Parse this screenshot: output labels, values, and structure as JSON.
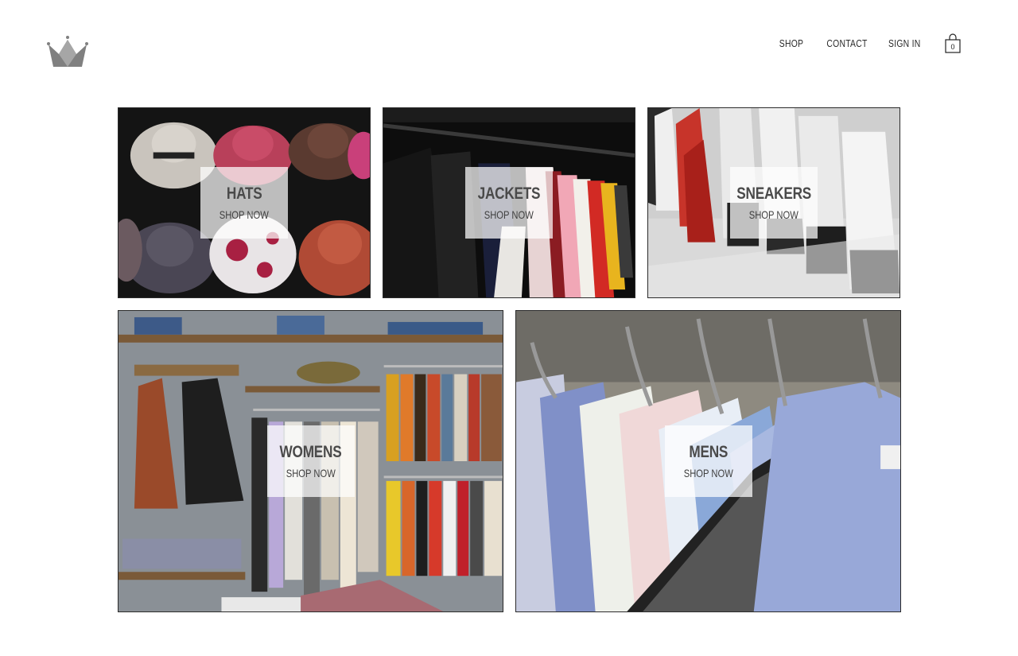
{
  "brand": {
    "logo_icon": "crown-icon",
    "logo_color": "#808080"
  },
  "nav": {
    "shop": "SHOP",
    "contact": "CONTACT",
    "sign_in": "SIGN IN",
    "cart_icon": "shopping-bag-icon",
    "cart_count": "0"
  },
  "categories": [
    {
      "title": "HATS",
      "subtitle": "SHOP NOW"
    },
    {
      "title": "JACKETS",
      "subtitle": "SHOP NOW"
    },
    {
      "title": "SNEAKERS",
      "subtitle": "SHOP NOW"
    },
    {
      "title": "WOMENS",
      "subtitle": "SHOP NOW"
    },
    {
      "title": "MENS",
      "subtitle": "SHOP NOW"
    }
  ]
}
